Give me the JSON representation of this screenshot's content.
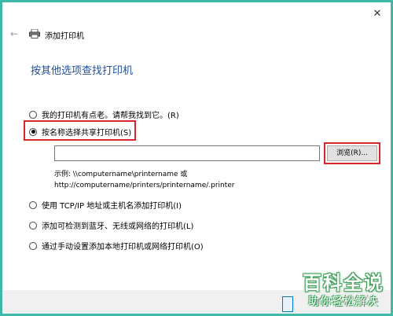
{
  "window": {
    "title": "添加打印机",
    "close_glyph": "✕",
    "back_glyph": "←"
  },
  "heading": "按其他选项查找打印机",
  "options": [
    {
      "label": "我的打印机有点老。请帮我找到它。(R)",
      "checked": false
    },
    {
      "label": "按名称选择共享打印机(S)",
      "checked": true
    },
    {
      "label": "使用 TCP/IP 地址或主机名添加打印机(I)",
      "checked": false
    },
    {
      "label": "添加可检测到蓝牙、无线或网络的打印机(L)",
      "checked": false
    },
    {
      "label": "通过手动设置添加本地打印机或网络打印机(O)",
      "checked": false
    }
  ],
  "shared_printer": {
    "value": "",
    "browse_label": "浏览(R)...",
    "example_line1": "示例: \\\\computername\\printername 或",
    "example_line2": "http://computername/printers/printername/.printer"
  },
  "watermark": {
    "main": "百科全说",
    "sub": "助你轻松解决"
  },
  "colors": {
    "background": "#3fb8a8",
    "heading": "#1e4f9a",
    "highlight": "#d9252a",
    "watermark_green": "#3a9c55"
  },
  "icons": {
    "title_icon": "printer-icon",
    "back": "back-arrow-icon",
    "close": "close-icon"
  }
}
